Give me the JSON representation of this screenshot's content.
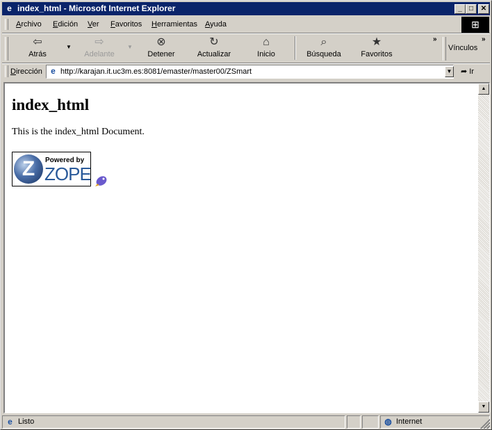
{
  "window": {
    "title": "index_html - Microsoft Internet Explorer",
    "controls": {
      "minimize": "_",
      "maximize": "□",
      "close": "✕"
    }
  },
  "menu": {
    "items": [
      "Archivo",
      "Edición",
      "Ver",
      "Favoritos",
      "Herramientas",
      "Ayuda"
    ]
  },
  "toolbar": {
    "back": "Atrás",
    "forward": "Adelante",
    "stop": "Detener",
    "refresh": "Actualizar",
    "home": "Inicio",
    "search": "Búsqueda",
    "favorites": "Favoritos",
    "links": "Vínculos",
    "chevron": "»"
  },
  "address": {
    "label": "Dirección",
    "url": "http://karajan.it.uc3m.es:8081/emaster/master00/ZSmart",
    "go": "Ir"
  },
  "page": {
    "heading": "index_html",
    "paragraph": "This is the index_html Document.",
    "badge": {
      "powered_by": "Powered by",
      "brand": "ZOPE"
    }
  },
  "status": {
    "text": "Listo",
    "zone": "Internet"
  },
  "colors": {
    "titlebar": "#0a246a",
    "chrome": "#d4d0c8",
    "zope_blue": "#2a5a9a"
  }
}
